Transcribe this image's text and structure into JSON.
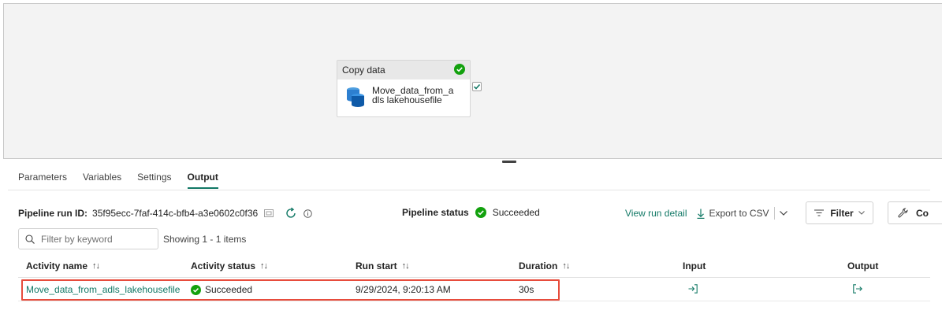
{
  "canvas": {
    "activity_type": "Copy data",
    "activity_name": "Move_data_from_a dls lakehousefile"
  },
  "tabs": [
    {
      "label": "Parameters"
    },
    {
      "label": "Variables"
    },
    {
      "label": "Settings"
    },
    {
      "label": "Output",
      "active": true
    }
  ],
  "run": {
    "id_label": "Pipeline run ID:",
    "id_value": "35f95ecc-7faf-414c-bfb4-a3e0602c0f36",
    "status_label": "Pipeline status",
    "status_value": "Succeeded"
  },
  "toolbar": {
    "view_run_detail": "View run detail",
    "export_csv": "Export to CSV",
    "filter": "Filter",
    "co": "Co"
  },
  "search": {
    "placeholder": "Filter by keyword",
    "showing": "Showing 1 - 1 items"
  },
  "table": {
    "headers": {
      "activity_name": "Activity name",
      "activity_status": "Activity status",
      "run_start": "Run start",
      "duration": "Duration",
      "input": "Input",
      "output": "Output"
    },
    "rows": [
      {
        "activity_name": "Move_data_from_adls_lakehousefile",
        "activity_status": "Succeeded",
        "run_start": "9/29/2024, 9:20:13 AM",
        "duration": "30s"
      }
    ]
  },
  "colors": {
    "accent": "#117865",
    "success": "#13a10e",
    "highlight": "#e74c3c"
  }
}
